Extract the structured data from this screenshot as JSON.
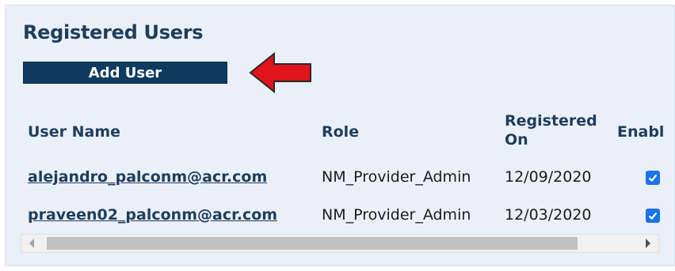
{
  "panel": {
    "title": "Registered Users",
    "add_button_label": "Add User"
  },
  "table": {
    "columns": [
      "User Name",
      "Role",
      "Registered On",
      "Enabl"
    ],
    "rows": [
      {
        "user_name": "alejandro_palconm@acr.com",
        "role": "NM_Provider_Admin",
        "registered_on": "12/09/2020",
        "enabled": true
      },
      {
        "user_name": "praveen02_palconm@acr.com",
        "role": "NM_Provider_Admin",
        "registered_on": "12/03/2020",
        "enabled": true
      }
    ]
  },
  "icons": {
    "annotation_arrow": "red-left-arrow",
    "checkbox": "checked-checkbox",
    "scroll_left": "scroll-left-arrow",
    "scroll_right": "scroll-right-arrow"
  },
  "colors": {
    "panel_bg": "#eaf0f8",
    "button_bg": "#0e3b5f",
    "heading": "#1f3d5c",
    "checkbox": "#1a73e8",
    "arrow": "#e1141b"
  }
}
